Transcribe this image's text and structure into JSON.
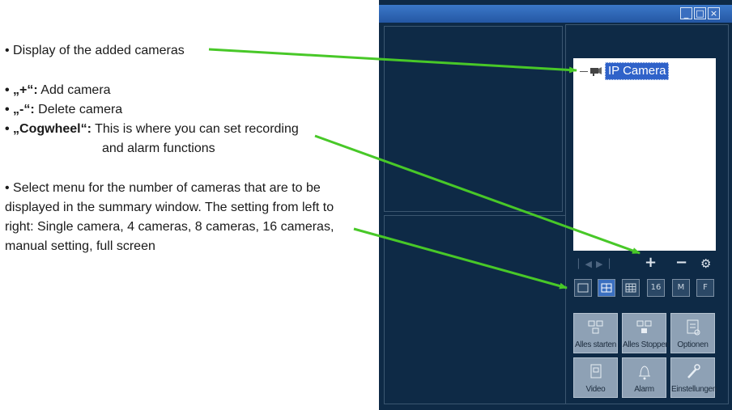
{
  "annotations": {
    "display": "• Display of the added cameras",
    "add_key": "• „+“:",
    "add_text": " Add camera",
    "delete_key": "• „-“:",
    "delete_text": " Delete camera",
    "cog_key": "• „Cogwheel“:",
    "cog_text": " This is where you can set recording",
    "cog_text2": "and alarm functions",
    "select_line1": "• Select menu for the number of cameras that are to be",
    "select_line2": "displayed in the summary window. The setting from left to",
    "select_line3": "right: Single camera, 4 cameras, 8 cameras, 16 cameras,",
    "select_line4": "manual setting, full screen"
  },
  "camera_list": {
    "item_label": "IP Camera"
  },
  "controls": {
    "add": "+",
    "delete": "−",
    "settings": "⚙"
  },
  "view_buttons": [
    "",
    "",
    "",
    "16",
    "M",
    "F"
  ],
  "action_buttons": [
    {
      "label": "Alles starten",
      "icon": "start-all-icon"
    },
    {
      "label": "Alles Stoppen",
      "icon": "stop-all-icon"
    },
    {
      "label": "Optionen",
      "icon": "options-icon"
    },
    {
      "label": "Video",
      "icon": "video-icon"
    },
    {
      "label": "Alarm",
      "icon": "bell-icon"
    },
    {
      "label": "Einstellungen",
      "icon": "wrench-icon"
    }
  ],
  "colors": {
    "arrow": "#48c828",
    "panel": "#0e2a46",
    "selection": "#2f62c9"
  }
}
